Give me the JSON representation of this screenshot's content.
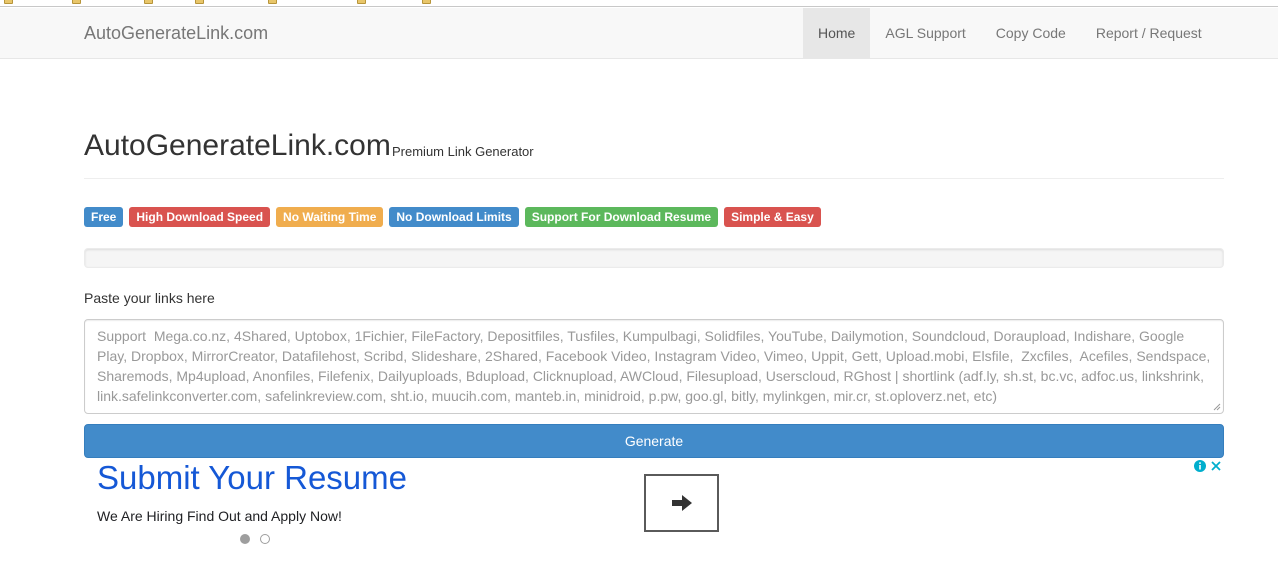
{
  "navbar": {
    "brand": "AutoGenerateLink.com",
    "items": [
      {
        "label": "Home",
        "active": true
      },
      {
        "label": "AGL Support",
        "active": false
      },
      {
        "label": "Copy Code",
        "active": false
      },
      {
        "label": "Report / Request",
        "active": false
      }
    ]
  },
  "header": {
    "title": "AutoGenerateLink.com",
    "subtitle": "Premium Link Generator"
  },
  "labels": [
    {
      "text": "Free",
      "color": "#428bca"
    },
    {
      "text": "High Download Speed",
      "color": "#d9534f"
    },
    {
      "text": "No Waiting Time",
      "color": "#f0ad4e"
    },
    {
      "text": "No Download Limits",
      "color": "#428bca"
    },
    {
      "text": "Support For Download Resume",
      "color": "#5cb85c"
    },
    {
      "text": "Simple & Easy",
      "color": "#d9534f"
    }
  ],
  "progress": {
    "value": 0
  },
  "form": {
    "paste_label": "Paste your links here",
    "textarea_placeholder": "Support  Mega.co.nz, 4Shared, Uptobox, 1Fichier, FileFactory, Depositfiles, Tusfiles, Kumpulbagi, Solidfiles, YouTube, Dailymotion, Soundcloud, Doraupload, Indishare, Google Play, Dropbox, MirrorCreator, Datafilehost, Scribd, Slideshare, 2Shared, Facebook Video, Instagram Video, Vimeo, Uppit, Gett, Upload.mobi, Elsfile,  Zxcfiles,  Acefiles, Sendspace, Sharemods, Mp4upload, Anonfiles, Filefenix, Dailyuploads, Bdupload, Clicknupload, AWCloud, Filesupload, Userscloud, RGhost | shortlink (adf.ly, sh.st, bc.vc, adfoc.us, linkshrink, link.safelinkconverter.com, safelinkreview.com, sht.io, muucih.com, manteb.in, minidroid, p.pw, goo.gl, bitly, mylinkgen, mir.cr, st.oploverz.net, etc)",
    "generate_label": "Generate"
  },
  "ad": {
    "headline": "Submit Your Resume",
    "description": "We Are Hiring Find Out and Apply Now!",
    "carousel_active_index": 0,
    "carousel_count": 2
  },
  "colors": {
    "primary": "#428bca",
    "danger": "#d9534f",
    "warning": "#f0ad4e",
    "success": "#5cb85c",
    "ad_link": "#1558d6"
  }
}
